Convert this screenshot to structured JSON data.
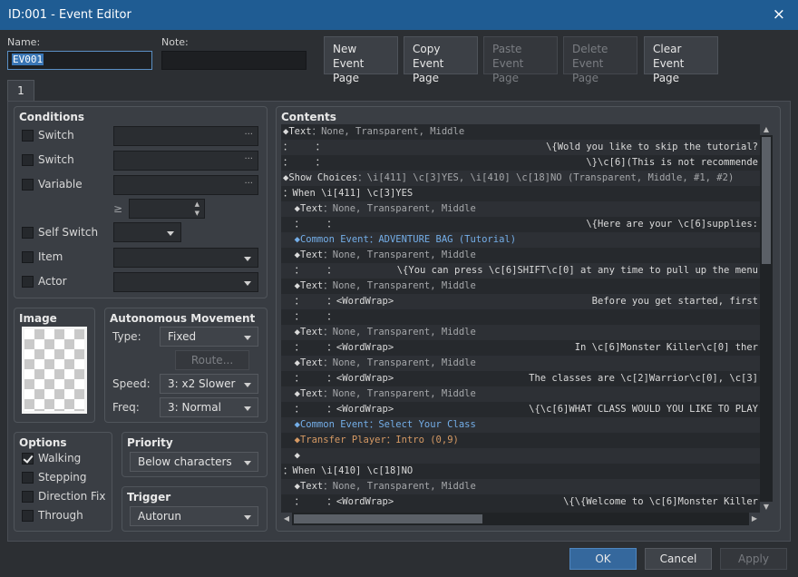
{
  "window": {
    "title": "ID:001 - Event Editor",
    "close_icon": "×"
  },
  "header": {
    "name_label": "Name:",
    "name_value": "EV001",
    "note_label": "Note:",
    "note_value": "",
    "buttons": {
      "new_page": [
        "New",
        "Event Page"
      ],
      "copy_page": [
        "Copy",
        "Event Page"
      ],
      "paste_page": [
        "Paste",
        "Event Page"
      ],
      "delete_page": [
        "Delete",
        "Event Page"
      ],
      "clear_page": [
        "Clear",
        "Event Page"
      ]
    }
  },
  "tabs": [
    "1"
  ],
  "conditions": {
    "title": "Conditions",
    "switch1": "Switch",
    "switch2": "Switch",
    "variable": "Variable",
    "gte_symbol": "≥",
    "self_switch": "Self Switch",
    "item": "Item",
    "actor": "Actor",
    "dots": "···"
  },
  "image": {
    "title": "Image"
  },
  "movement": {
    "title": "Autonomous Movement",
    "type_label": "Type:",
    "type_value": "Fixed",
    "route_button": "Route...",
    "speed_label": "Speed:",
    "speed_value": "3: x2 Slower",
    "freq_label": "Freq:",
    "freq_value": "3: Normal"
  },
  "options": {
    "title": "Options",
    "walking": "Walking",
    "stepping": "Stepping",
    "direction_fix": "Direction Fix",
    "through": "Through"
  },
  "priority": {
    "title": "Priority",
    "value": "Below characters"
  },
  "trigger": {
    "title": "Trigger",
    "value": "Autorun"
  },
  "contents": {
    "title": "Contents",
    "rows": [
      {
        "a": "◆Text",
        "b": "：None, Transparent, Middle",
        "r": ""
      },
      {
        "a": "：    ：",
        "b": "",
        "r": "\\{Wold you like to skip the tutorial?"
      },
      {
        "a": "：    ：",
        "b": "",
        "r": "\\}\\c[6](This is not recommende"
      },
      {
        "a": "◆Show Choices",
        "b": "：\\i[411] \\c[3]YES, \\i[410] \\c[18]NO (Transparent, Middle, #1, #2)",
        "r": ""
      },
      {
        "a": "：When \\i[411] \\c[3]YES",
        "b": "",
        "r": ""
      },
      {
        "a": "  ◆Text",
        "b": "：None, Transparent, Middle",
        "r": ""
      },
      {
        "a": "  ：    ：",
        "b": "",
        "r": "\\{Here are your \\c[6]supplies:"
      },
      {
        "a": "  ◆Common Event",
        "b": "：ADVENTURE BAG (Tutorial)",
        "r": "",
        "blue": true
      },
      {
        "a": "  ◆Text",
        "b": "：None, Transparent, Middle",
        "r": ""
      },
      {
        "a": "  ：    ：",
        "b": "",
        "r": "\\{You can press \\c[6]SHIFT\\c[0] at any time to pull up the menu"
      },
      {
        "a": "  ◆Text",
        "b": "：None, Transparent, Middle",
        "r": ""
      },
      {
        "a": "  ：    ：<WordWrap>",
        "b": "",
        "r": "Before you get started, first"
      },
      {
        "a": "  ：    ：",
        "b": "",
        "r": ""
      },
      {
        "a": "  ◆Text",
        "b": "：None, Transparent, Middle",
        "r": ""
      },
      {
        "a": "  ：    ：<WordWrap>",
        "b": "",
        "r": "In \\c[6]Monster Killer\\c[0] ther"
      },
      {
        "a": "  ◆Text",
        "b": "：None, Transparent, Middle",
        "r": ""
      },
      {
        "a": "  ：    ：<WordWrap>",
        "b": "",
        "r": "The classes are \\c[2]Warrior\\c[0], \\c[3]"
      },
      {
        "a": "  ◆Text",
        "b": "：None, Transparent, Middle",
        "r": ""
      },
      {
        "a": "  ：    ：<WordWrap>",
        "b": "",
        "r": "\\{\\c[6]WHAT CLASS WOULD YOU LIKE TO PLAY"
      },
      {
        "a": "  ◆Common Event",
        "b": "：Select Your Class",
        "r": "",
        "blue": true
      },
      {
        "a": "  ◆Transfer Player",
        "b": "：Intro (0,9)",
        "r": "",
        "orange": true
      },
      {
        "a": "  ◆",
        "b": "",
        "r": ""
      },
      {
        "a": "：When \\i[410] \\c[18]NO",
        "b": "",
        "r": ""
      },
      {
        "a": "  ◆Text",
        "b": "：None, Transparent, Middle",
        "r": ""
      },
      {
        "a": "  ：    ：<WordWrap>",
        "b": "",
        "r": "\\{\\{Welcome to \\c[6]Monster Killer"
      }
    ]
  },
  "footer": {
    "ok": "OK",
    "cancel": "Cancel",
    "apply": "Apply"
  }
}
